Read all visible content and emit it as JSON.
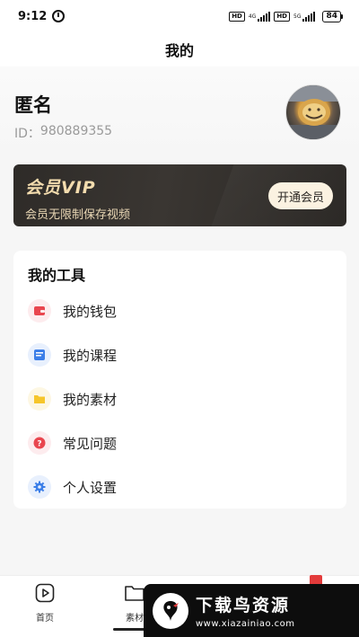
{
  "status_bar": {
    "time": "9:12",
    "hd1": "HD",
    "net1": "4G",
    "hd2": "HD",
    "net2": "5G",
    "battery": "84"
  },
  "header": {
    "title": "我的"
  },
  "profile": {
    "name": "匿名",
    "id_label": "ID：",
    "id_value": "980889355"
  },
  "vip": {
    "title": "会员VIP",
    "subtitle": "会员无限制保存视频",
    "button_label": "开通会员",
    "accent_color": "#f3dcae"
  },
  "tools": {
    "title": "我的工具",
    "items": [
      {
        "label": "我的钱包",
        "icon": "wallet-icon",
        "color": "#e9464f",
        "bg": "#fdecee"
      },
      {
        "label": "我的课程",
        "icon": "document-icon",
        "color": "#3b7ee8",
        "bg": "#e8f0fd"
      },
      {
        "label": "我的素材",
        "icon": "folder-icon",
        "color": "#f6c62b",
        "bg": "#fdf7e3"
      },
      {
        "label": "常见问题",
        "icon": "question-icon",
        "color": "#e9464f",
        "bg": "#fdecee"
      },
      {
        "label": "个人设置",
        "icon": "gear-icon",
        "color": "#3b7ee8",
        "bg": "#e8f0fd"
      }
    ]
  },
  "bottom_nav": {
    "items": [
      {
        "label": "首页",
        "icon": "play-icon"
      },
      {
        "label": "素材",
        "icon": "folder-icon"
      }
    ]
  },
  "watermark": {
    "title": "下载鸟资源",
    "url": "www.xiazainiao.com"
  }
}
